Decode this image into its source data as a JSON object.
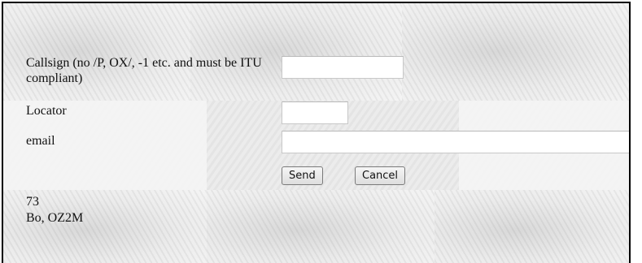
{
  "form": {
    "callsign_label": "Callsign (no /P, OX/, -1 etc. and must be ITU compliant)",
    "callsign_value": "",
    "locator_label": "Locator",
    "locator_value": "",
    "email_label": "email",
    "email_value": "",
    "send_label": "Send",
    "cancel_label": "Cancel"
  },
  "signature": {
    "line1": "73",
    "line2": "Bo, OZ2M"
  }
}
